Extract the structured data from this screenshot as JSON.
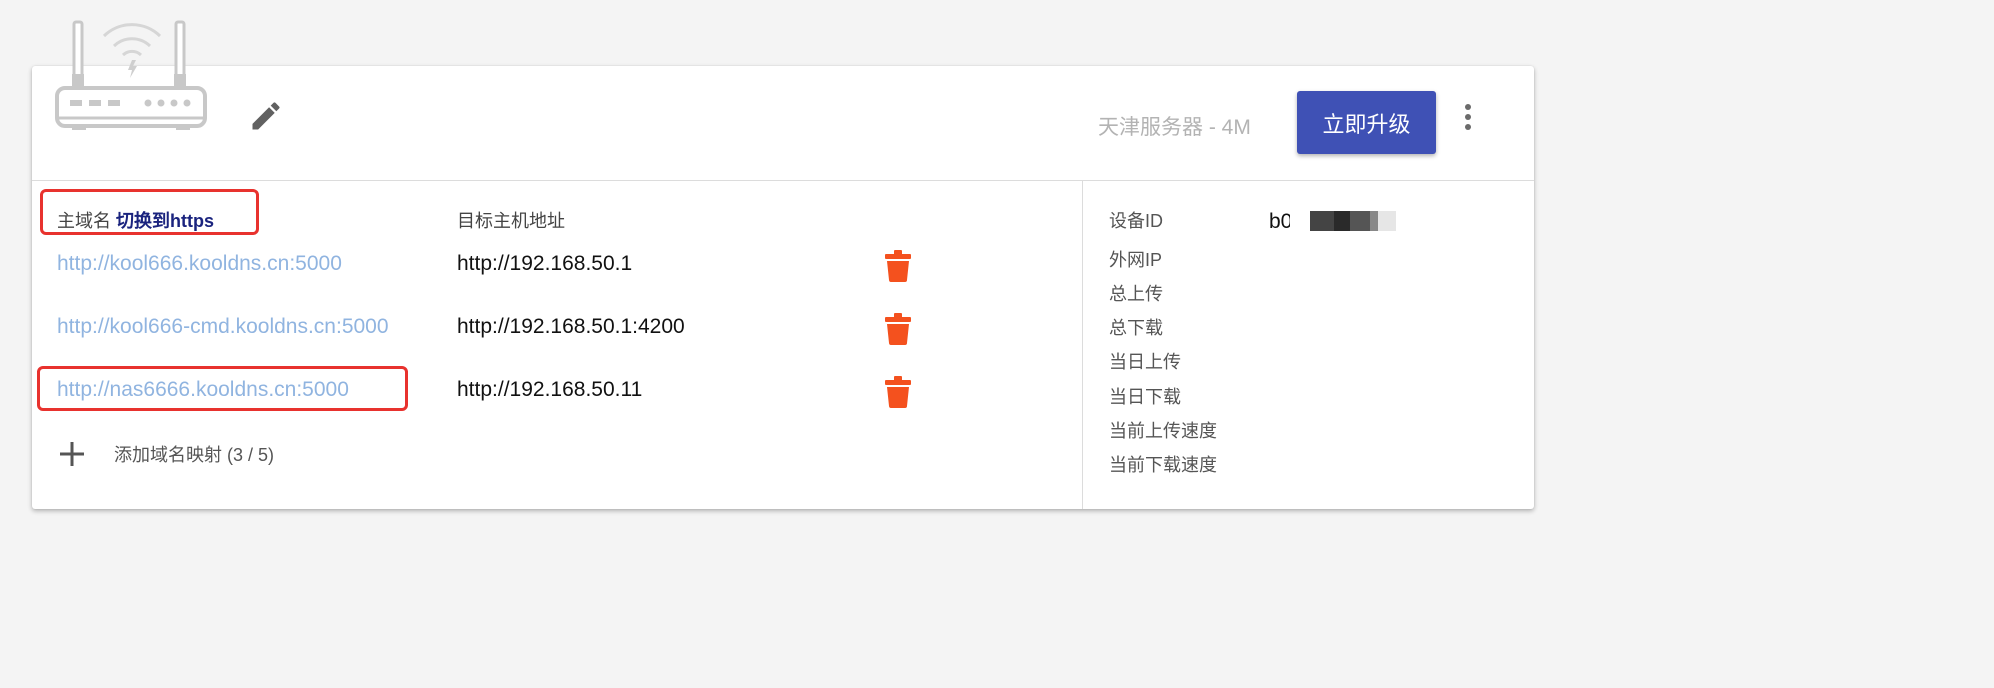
{
  "colors": {
    "page_background": "#f4f4f4",
    "accent": "#3f51b5",
    "link": "#90b4e0",
    "https_link": "#1a237e",
    "delete": "#f4511e",
    "highlight": "#e8322e"
  },
  "header": {
    "router_icon": "router-icon",
    "edit_icon": "pencil-icon",
    "server": "天津服务器 - 4M",
    "upgrade_label": "立即升级",
    "more_icon": "more-vert-icon"
  },
  "mappings": {
    "domain_header": "主域名",
    "switch_https": "切换到https",
    "target_header": "目标主机地址",
    "rows": [
      {
        "domain": "http://kool666.kooldns.cn:5000",
        "target": "http://192.168.50.1"
      },
      {
        "domain": "http://kool666-cmd.kooldns.cn:5000",
        "target": "http://192.168.50.1:4200"
      },
      {
        "domain": "http://nas6666.kooldns.cn:5000",
        "target": "http://192.168.50.11"
      }
    ],
    "delete_icon": "trash-icon",
    "add_icon": "plus-icon",
    "add_label": "添加域名映射 (3 / 5)"
  },
  "info": {
    "labels": [
      "设备ID",
      "外网IP",
      "总上传",
      "总下载",
      "当日上传",
      "当日下载",
      "当前上传速度",
      "当前下载速度"
    ],
    "device_id": "b0c           a0"
  }
}
